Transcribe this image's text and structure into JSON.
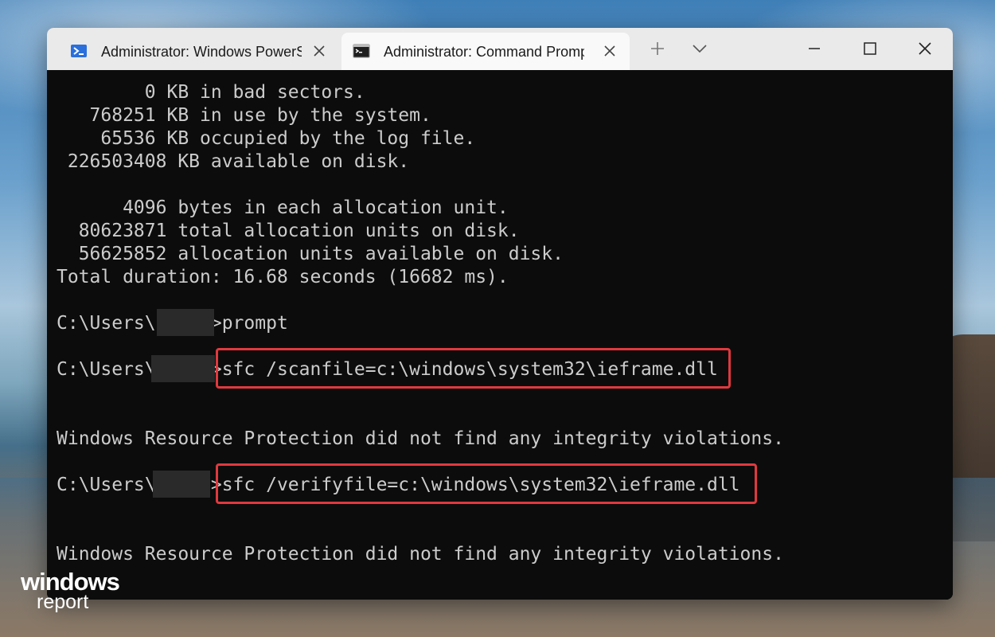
{
  "tabs": [
    {
      "title": "Administrator: Windows PowerS",
      "icon": "powershell-icon",
      "active": false
    },
    {
      "title": "Administrator: Command Promp",
      "icon": "command-prompt-icon",
      "active": true
    }
  ],
  "titlebar": {
    "new_tab_icon": "plus-icon",
    "dropdown_icon": "chevron-down-icon",
    "minimize_icon": "minimize-icon",
    "maximize_icon": "maximize-icon",
    "close_icon": "close-icon"
  },
  "console": {
    "lines": [
      "        0 KB in bad sectors.",
      "   768251 KB in use by the system.",
      "    65536 KB occupied by the log file.",
      " 226503408 KB available on disk.",
      "",
      "      4096 bytes in each allocation unit.",
      "  80623871 total allocation units on disk.",
      "  56625852 allocation units available on disk.",
      "Total duration: 16.68 seconds (16682 ms).",
      "",
      "C:\\Users\\     >prompt",
      "",
      "C:\\Users\\     >sfc /scanfile=c:\\windows\\system32\\ieframe.dll",
      "",
      "",
      "Windows Resource Protection did not find any integrity violations.",
      "",
      "C:\\Users\\     >sfc /verifyfile=c:\\windows\\system32\\ieframe.dll",
      "",
      "",
      "Windows Resource Protection did not find any integrity violations."
    ],
    "highlight_color": "#e0393e",
    "text_color": "#cccccc",
    "background_color": "#0c0c0c"
  },
  "watermark": {
    "line1": "windows",
    "line2": "report"
  }
}
